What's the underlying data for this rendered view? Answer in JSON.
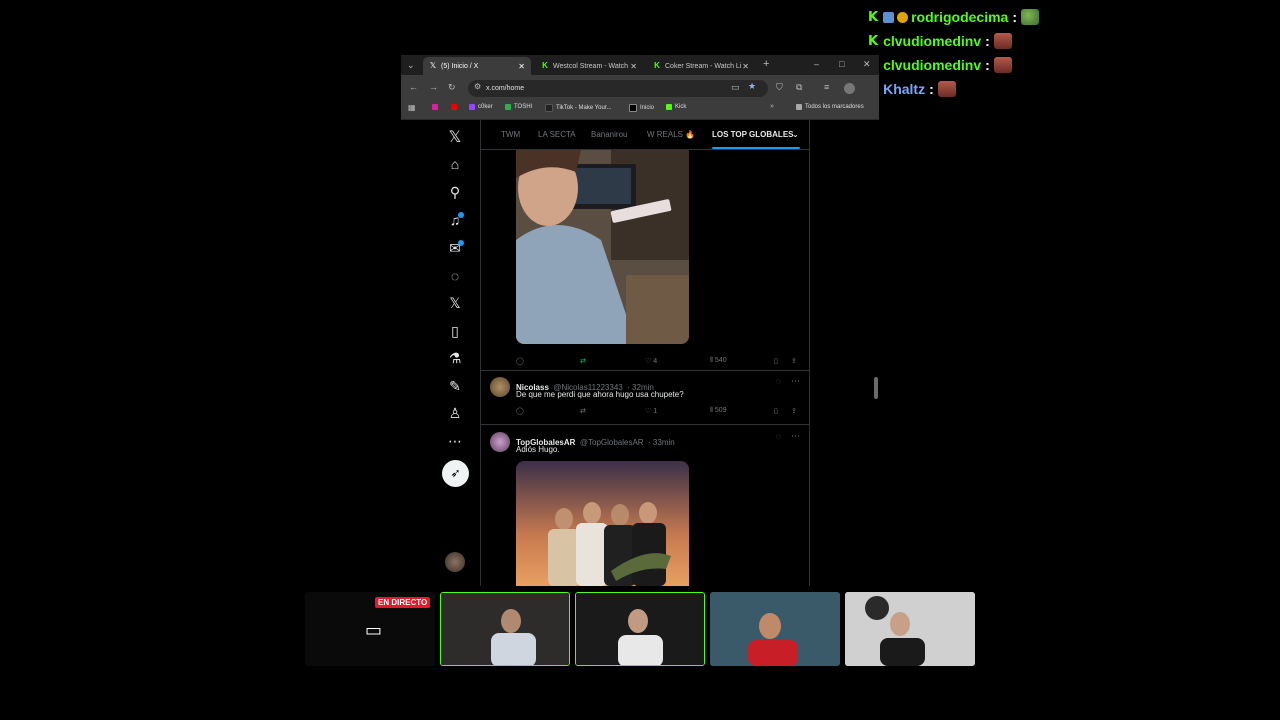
{
  "chat": [
    {
      "user": "rodrigodecima",
      "emote": "frog",
      "badges": true,
      "color": "#53fc18"
    },
    {
      "user": "clvudiomedinv",
      "emote": "face",
      "badges": false,
      "color": "#53fc18"
    },
    {
      "user": "clvudiomedinv",
      "emote": "face",
      "badges": false,
      "color": "#53fc18"
    },
    {
      "user": "Khaltz",
      "emote": "face",
      "badges": false,
      "color": "#7aa6f5"
    }
  ],
  "chat_colon": ":",
  "browser": {
    "tabs": [
      {
        "title": "(5) Inicio / X",
        "icon": "x-icon"
      },
      {
        "title": "Westcol Stream - Watch",
        "icon": "kick-icon"
      },
      {
        "title": "Coker Stream - Watch Li",
        "icon": "kick-icon"
      }
    ],
    "url": "x.com/home",
    "bookmarks": [
      "c0ker",
      "TOSHI",
      "TikTok - Make Your...",
      "Inicio",
      "Kick"
    ],
    "bookmarks_folder": "Todos los marcadores"
  },
  "x": {
    "tabs": [
      "TWM",
      "LA SECTA",
      "Bananirou",
      "W REALS 🔥",
      "LOS TOP GLOBALES"
    ],
    "tweet1_stats": {
      "likes": "4",
      "views": "540"
    },
    "tweet2": {
      "name": "Nicolass",
      "handle": "@Nicolas11223343",
      "time": "· 32min",
      "text": "De que me perdi que ahora hugo usa chupete?",
      "likes": "1",
      "views": "509"
    },
    "tweet3": {
      "name": "TopGlobalesAR",
      "handle": "@TopGlobalesAR",
      "time": "· 33min",
      "text": "Adiós Hugo."
    }
  },
  "live_badge": "EN DIRECTO",
  "colors": {
    "kick_green": "#53fc18",
    "x_blue": "#1d9bf0",
    "live_red": "#e5192b"
  }
}
